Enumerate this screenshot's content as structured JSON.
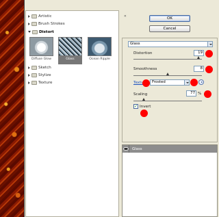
{
  "gallery": {
    "categories": [
      {
        "label": "Artistic",
        "expanded": false
      },
      {
        "label": "Brush Strokes",
        "expanded": false
      },
      {
        "label": "Distort",
        "expanded": true
      },
      {
        "label": "Sketch",
        "expanded": false
      },
      {
        "label": "Stylize",
        "expanded": false
      },
      {
        "label": "Texture",
        "expanded": false
      }
    ],
    "thumbnails": [
      {
        "label": "Diffuse Glow",
        "selected": false
      },
      {
        "label": "Glass",
        "selected": true
      },
      {
        "label": "Ocean Ripple",
        "selected": false
      }
    ]
  },
  "dialog": {
    "ok_label": "OK",
    "cancel_label": "Cancel",
    "collapse_glyph": "«"
  },
  "settings": {
    "filter_select": "Glass",
    "distortion": {
      "label": "Distortion",
      "value": "19",
      "slider_fraction": 0.95
    },
    "smoothness": {
      "label": "Smoothness",
      "value": "8",
      "slider_fraction": 0.5
    },
    "texture": {
      "label": "Texture:",
      "value": "Frosted"
    },
    "scaling": {
      "label": "Scaling",
      "value": "77",
      "unit": "%",
      "slider_fraction": 0.15
    },
    "invert": {
      "label": "Invert",
      "checked": true
    }
  },
  "layers": {
    "items": [
      {
        "name": "Glass",
        "visible": true
      }
    ]
  },
  "colors": {
    "annotation_dot": "#ff0000",
    "panel_bg": "#ece9d8",
    "selected_layer": "#8d8d8d"
  }
}
